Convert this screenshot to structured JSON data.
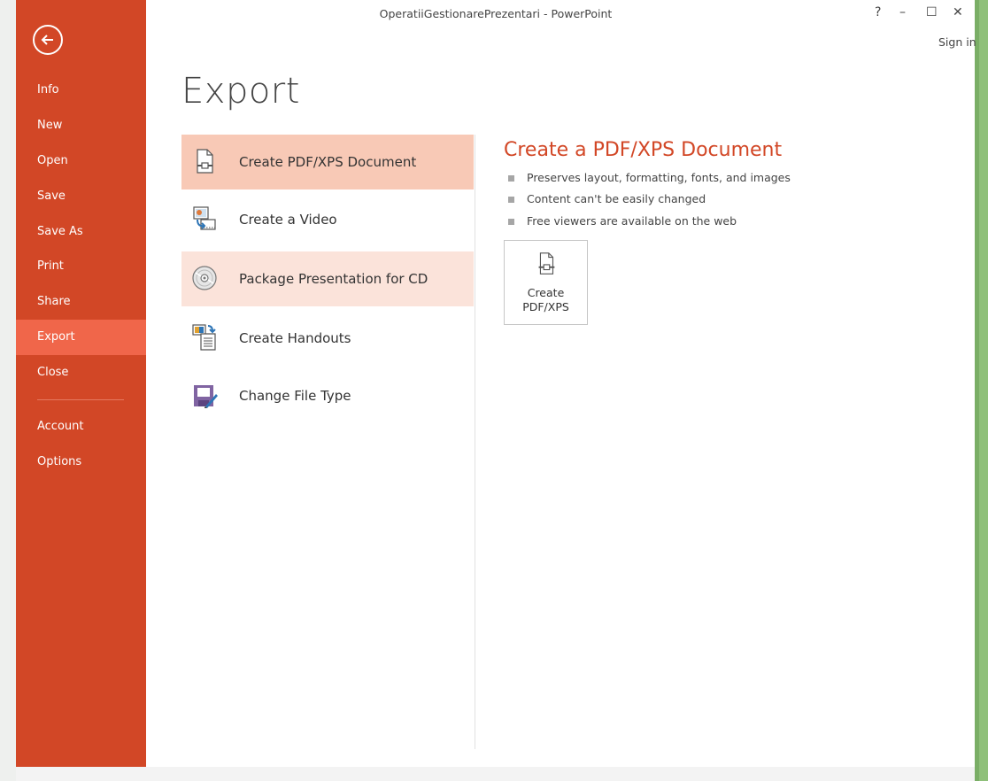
{
  "window": {
    "title": "OperatiiGestionarePrezentari - PowerPoint",
    "help_label": "?",
    "minimize_label": "–",
    "maximize_label": "☐",
    "close_label": "✕",
    "sign_in": "Sign in"
  },
  "nav": {
    "items": [
      {
        "label": "Info"
      },
      {
        "label": "New"
      },
      {
        "label": "Open"
      },
      {
        "label": "Save"
      },
      {
        "label": "Save As"
      },
      {
        "label": "Print"
      },
      {
        "label": "Share"
      },
      {
        "label": "Export",
        "active": true
      },
      {
        "label": "Close"
      },
      {
        "label": "Account"
      },
      {
        "label": "Options"
      }
    ]
  },
  "page": {
    "title": "Export"
  },
  "options": [
    {
      "label": "Create PDF/XPS Document",
      "icon": "pdf-document-icon",
      "state": "selected"
    },
    {
      "label": "Create a Video",
      "icon": "video-icon"
    },
    {
      "label": "Package Presentation for CD",
      "icon": "cd-icon",
      "state": "hover"
    },
    {
      "label": "Create Handouts",
      "icon": "handouts-icon"
    },
    {
      "label": "Change File Type",
      "icon": "file-type-icon"
    }
  ],
  "detail": {
    "title": "Create a PDF/XPS Document",
    "bullets": [
      "Preserves layout, formatting, fonts, and images",
      "Content can't be easily changed",
      "Free viewers are available on the web"
    ],
    "button": {
      "line1": "Create",
      "line2": "PDF/XPS"
    }
  },
  "colors": {
    "accent": "#d24726",
    "nav_active": "#f0664a",
    "option_selected": "#f8c9b6",
    "option_hover": "#fbe3da"
  }
}
